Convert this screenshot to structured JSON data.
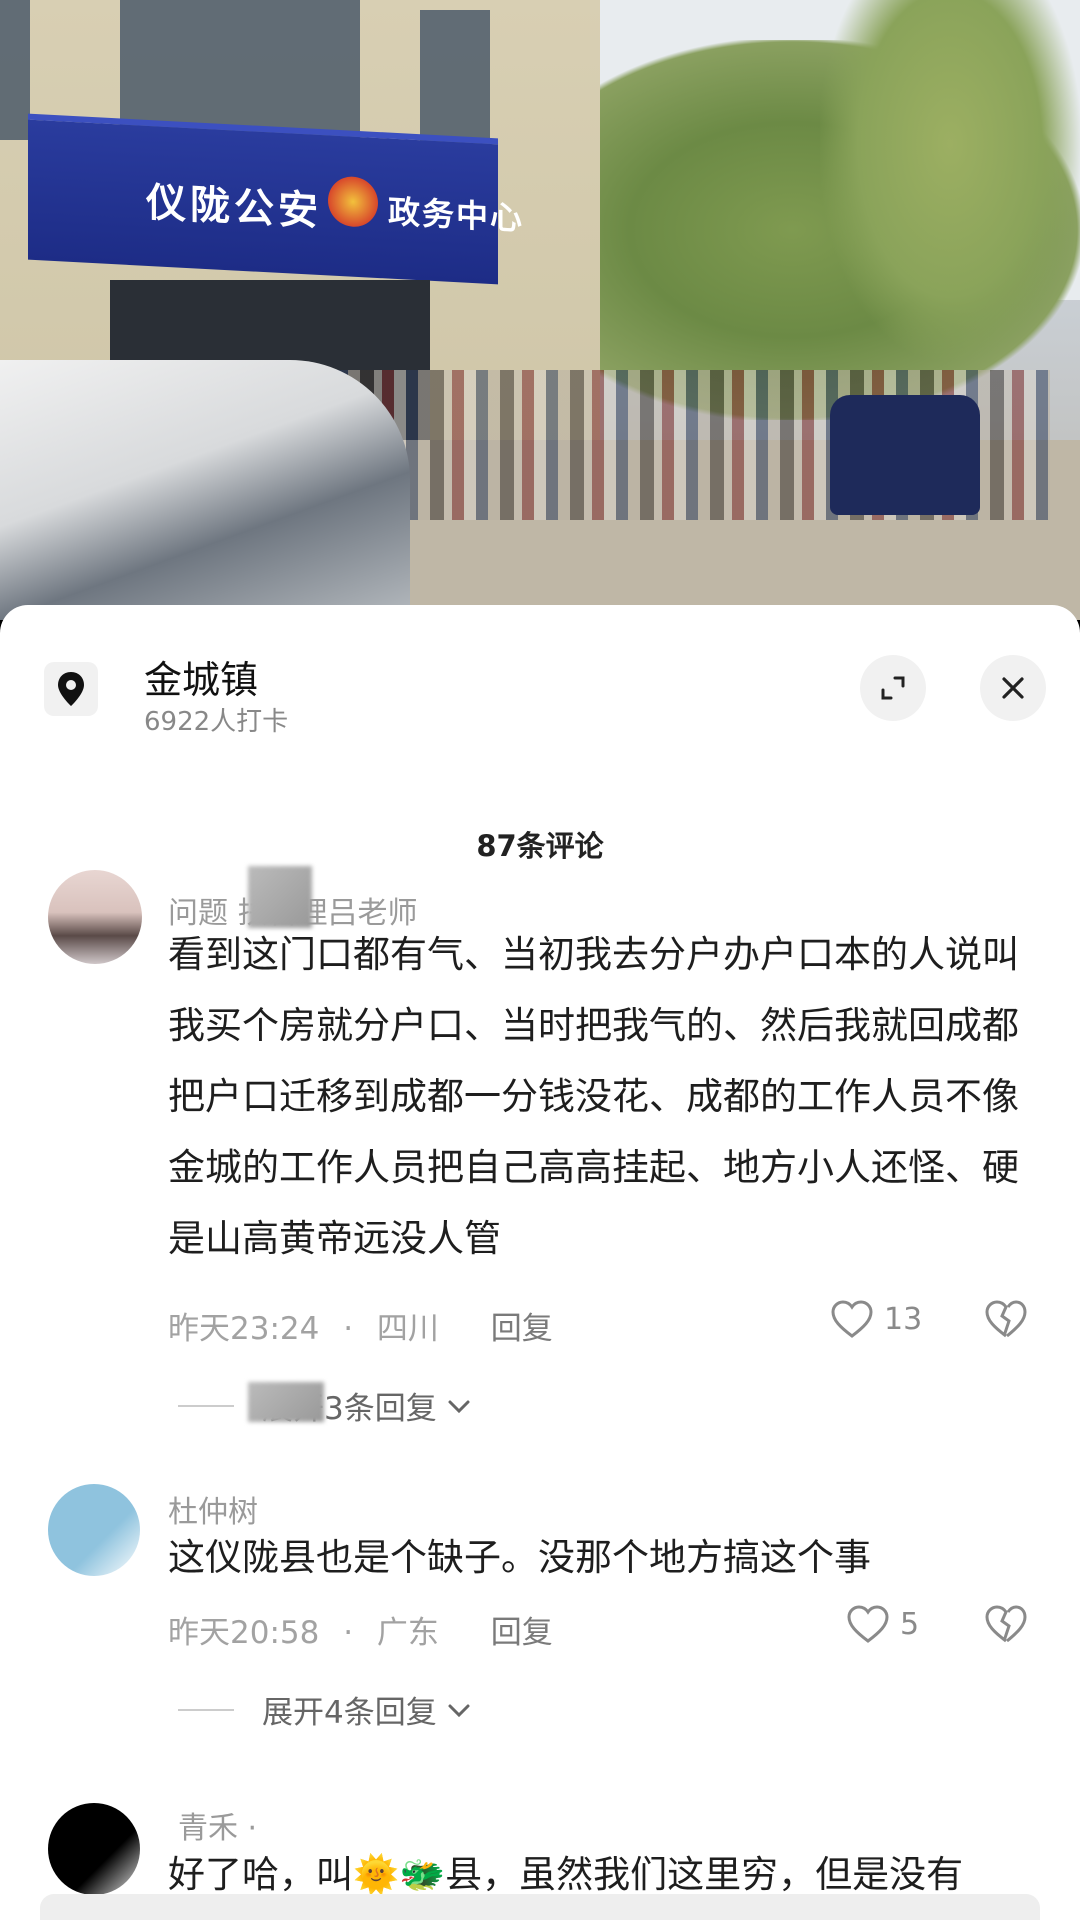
{
  "photo": {
    "sign_left": "仪陇公安",
    "sign_right": "政务中心"
  },
  "location": {
    "name": "金城镇",
    "checkins": "6922人打卡",
    "icon": "location-pin-icon"
  },
  "comment_count": "87条评论",
  "comments": [
    {
      "user": "问题   扶管理吕老师",
      "body": "看到这门口都有气、当初我去分户办户口本的人说叫我买个房就分户口、当时把我气的、然后我就回成都把户口迁移到成都一分钱没花、成都的工作人员不像金城的工作人员把自己高高挂起、地方小人还怪、硬是山高黄帝远没人管",
      "time": "昨天23:24",
      "region": "四川",
      "reply": "回复",
      "likes": "13",
      "expand": "展开3条回复"
    },
    {
      "user": "杜仲树",
      "body": "这仪陇县也是个缺子。没那个地方搞这个事",
      "time": "昨天20:58",
      "region": "广东",
      "reply": "回复",
      "likes": "5",
      "expand": "展开4条回复"
    },
    {
      "user": "青禾 ·",
      "body": "好了哈，叫🌞🐲县，虽然我们这里穷，但是没有",
      "time": "",
      "region": "",
      "reply": "",
      "likes": "",
      "expand": ""
    }
  ],
  "separator": "·",
  "colors": {
    "sheet_bg": "#ffffff",
    "muted": "#a2a2a2",
    "sign_blue": "#1d2c86"
  }
}
